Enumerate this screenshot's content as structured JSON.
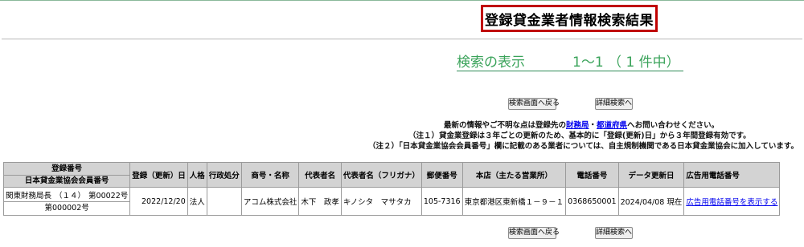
{
  "page": {
    "title": "登録貸金業者情報検索結果",
    "count_label": "検索の表示",
    "count_range": "1～1 （ 1 件中）"
  },
  "buttons": {
    "back_label": "検索画面へ戻る",
    "detail_label": "詳細検索へ"
  },
  "notice": {
    "line1_pre": "最新の情報やご不明な点は登録先の",
    "link_bureau": "財務局",
    "sep": "・",
    "link_pref": "都道府県",
    "line1_post": "へお問い合わせください。",
    "line2": "（注１）貸金業登録は３年ごとの更新のため、基本的に「登録(更新)日」から３年間登録有効です。",
    "line3": "（注２）「日本貸金業協会会員番号」欄に記載のある業者については、自主規制機関である日本貸金業協会に加入しています。"
  },
  "table": {
    "headers": {
      "reg_no": "登録番号",
      "assoc_no": "日本貸金業協会会員番号",
      "reg_date": "登録（更新）日",
      "entity": "人格",
      "admin": "行政処分",
      "name": "商号・名称",
      "rep": "代表者名",
      "rep_kana": "代表者名（フリガナ）",
      "postal": "郵便番号",
      "address": "本店（主たる営業所）",
      "phone": "電話番号",
      "updated": "データ更新日",
      "ad_phone": "広告用電話番号"
    },
    "rows": [
      {
        "bureau": "関東財務局長",
        "renewals": "（１４）",
        "reg_no": "第00022号",
        "assoc_no": "第000002号",
        "reg_date": "2022/12/20",
        "entity": "法人",
        "admin": "",
        "name": "アコム株式会社",
        "rep": "木下　政孝",
        "rep_kana": "キノシタ　マサタカ",
        "postal": "105-7316",
        "address": "東京都港区東新橋１－９－１",
        "phone": "0368650001",
        "updated": "2024/04/08 現在",
        "ad_phone_link": "広告用電話番号を表示する"
      }
    ]
  }
}
